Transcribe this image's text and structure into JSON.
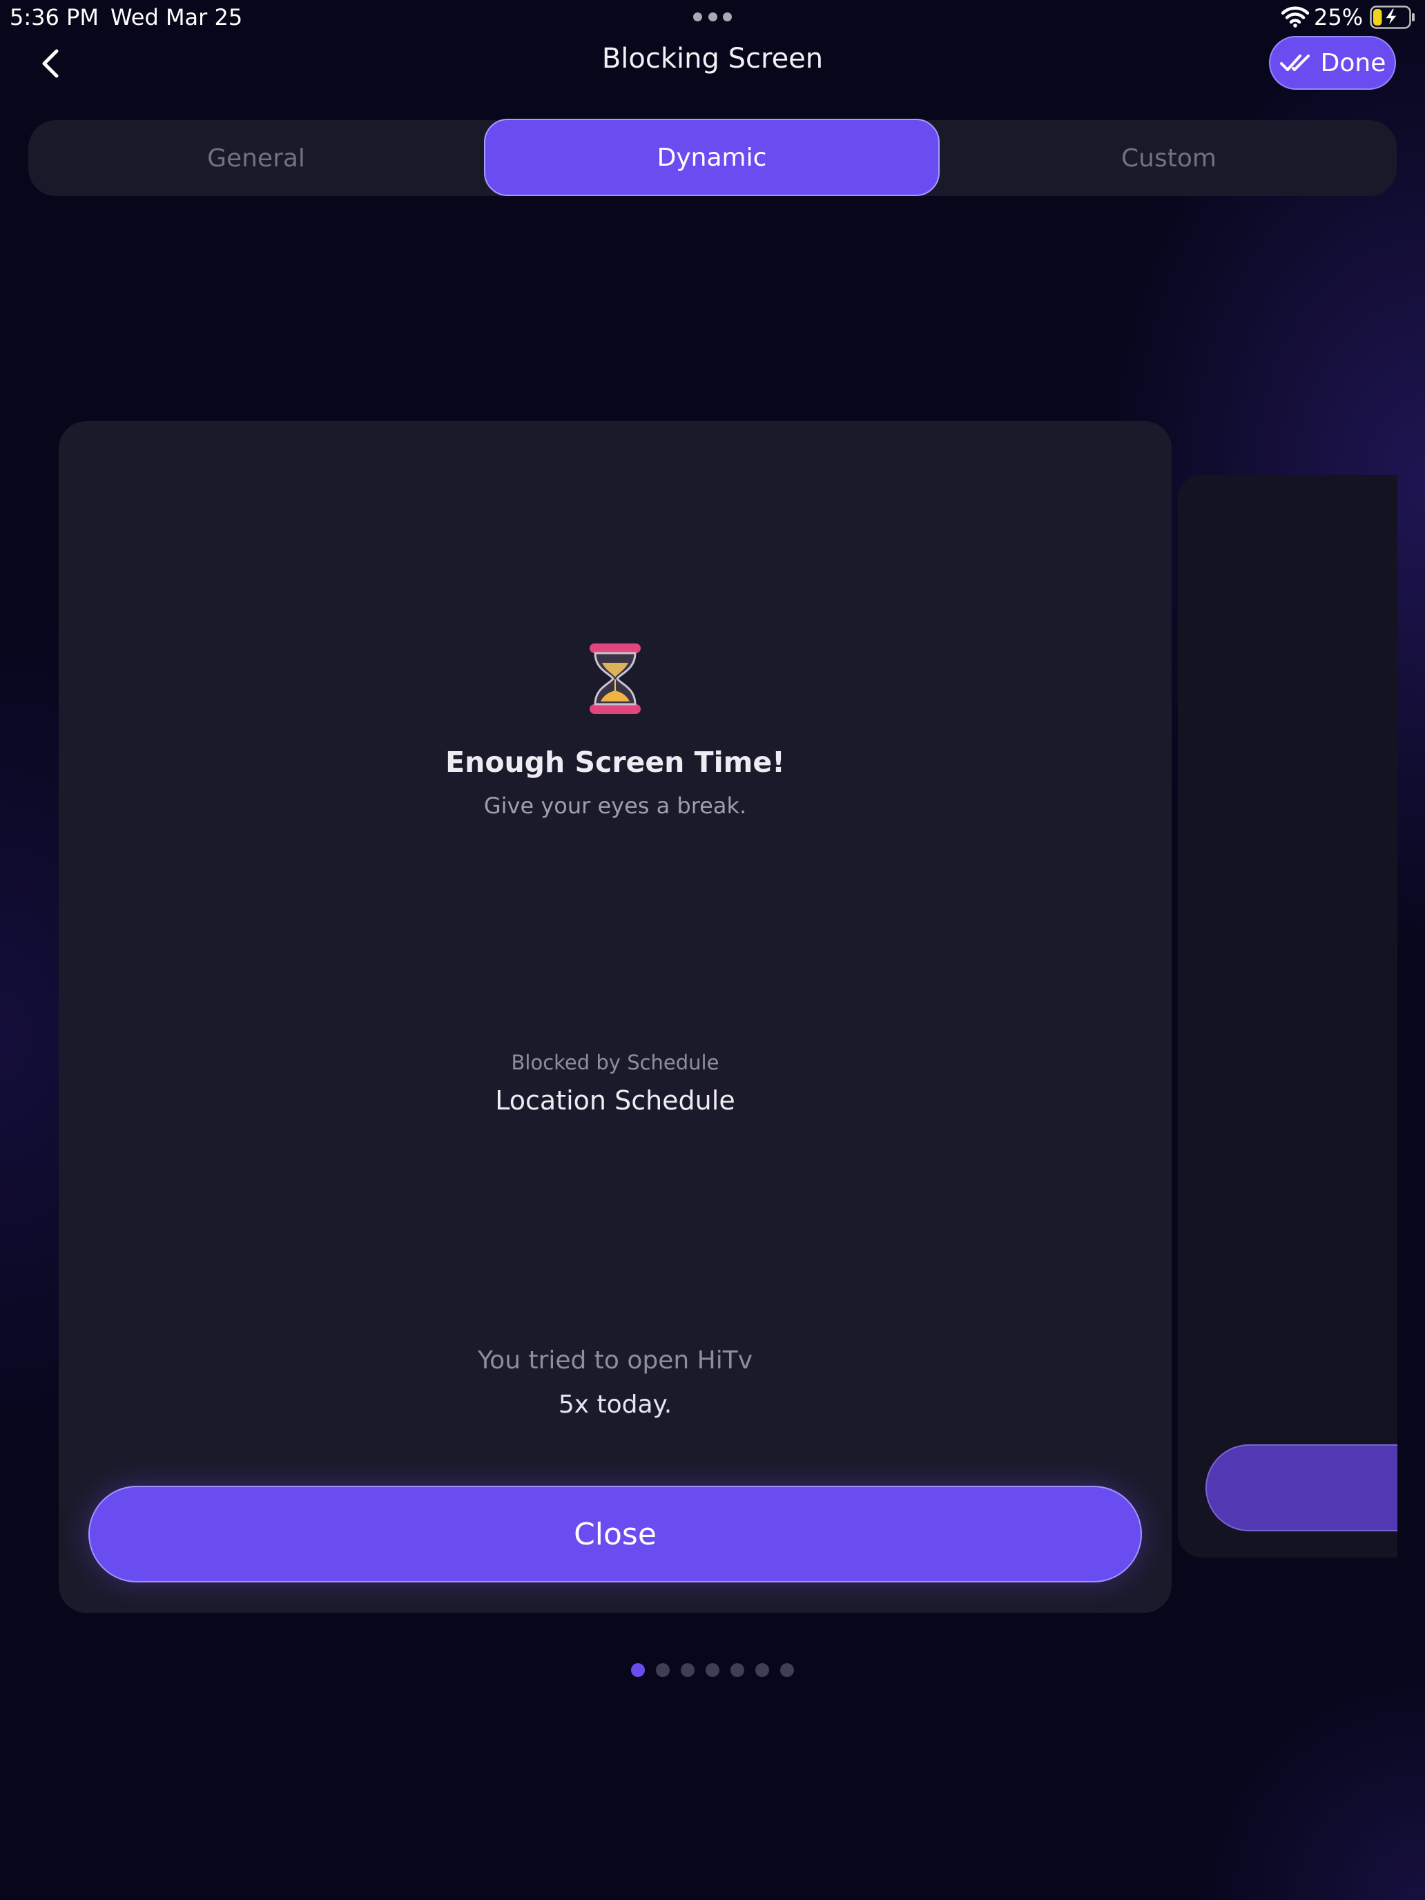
{
  "status_bar": {
    "time": "5:36 PM",
    "date": "Wed Mar 25",
    "battery_percent": "25%",
    "battery_level": 0.25,
    "icons": [
      "wifi-icon",
      "battery-charging-icon"
    ]
  },
  "nav": {
    "back_icon": "chevron-left-icon",
    "title": "Blocking Screen",
    "done_icon": "double-check-icon",
    "done_label": "Done"
  },
  "tabs": [
    {
      "label": "General",
      "active": false
    },
    {
      "label": "Dynamic",
      "active": true
    },
    {
      "label": "Custom",
      "active": false
    }
  ],
  "card": {
    "icon": "hourglass-icon",
    "heading": "Enough Screen Time!",
    "subheading": "Give your eyes a break.",
    "blocked_label": "Blocked by Schedule",
    "schedule_name": "Location Schedule",
    "tried_line": "You tried to open HiTv",
    "count_line": "5x today.",
    "close_label": "Close"
  },
  "pagination": {
    "total": 7,
    "current": 1
  },
  "colors": {
    "accent": "#6A4DF0",
    "background": "#07061A",
    "card": "#1B1A2A",
    "segment_bg": "#1A1929"
  }
}
